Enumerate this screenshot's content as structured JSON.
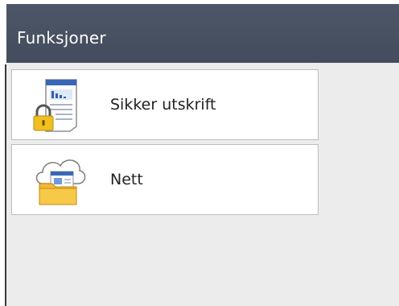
{
  "header": {
    "title": "Funksjoner"
  },
  "menu": {
    "items": [
      {
        "label": "Sikker utskrift",
        "icon": "secure-print-icon"
      },
      {
        "label": "Nett",
        "icon": "web-cloud-folder-icon"
      }
    ]
  },
  "colors": {
    "title_bar": "#48515f",
    "background": "#ececec",
    "item_background": "#ffffff",
    "lock": "#f0c020",
    "folder": "#f7c948"
  }
}
